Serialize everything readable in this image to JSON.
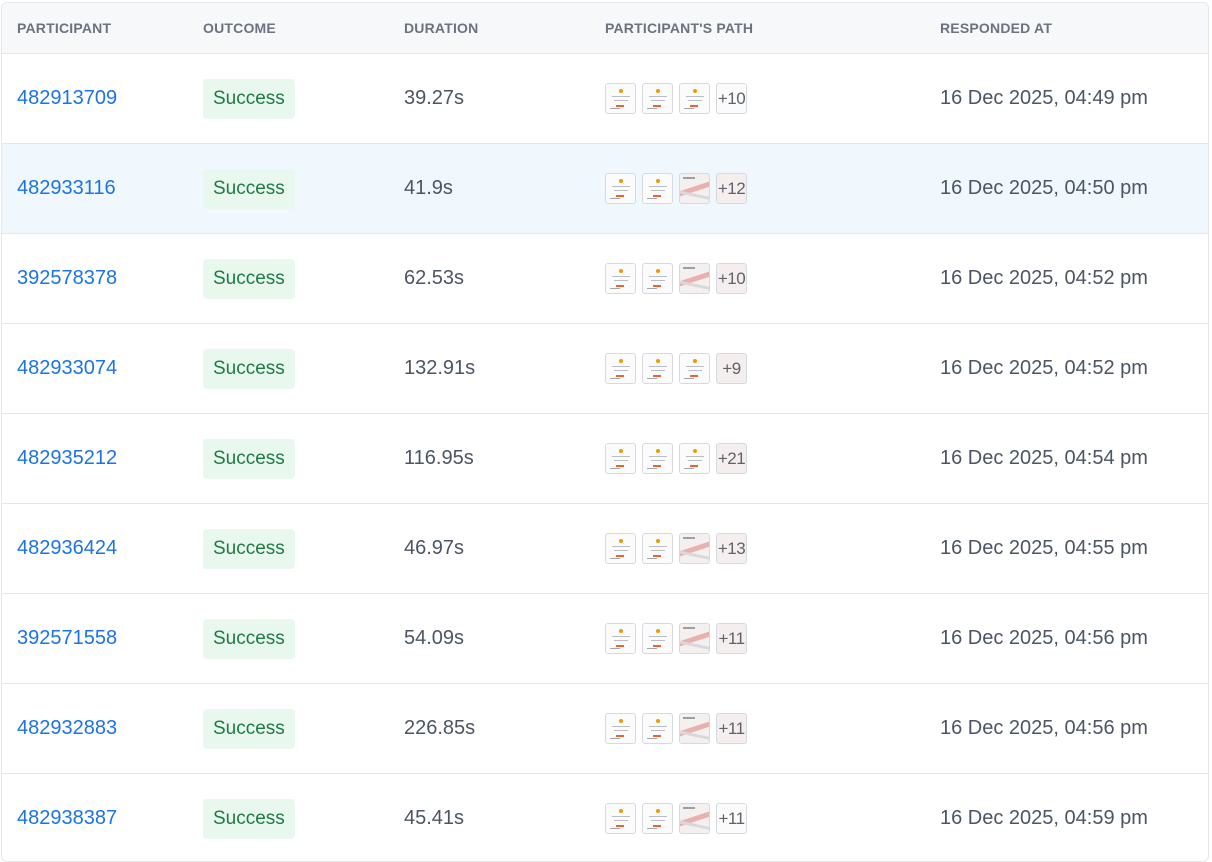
{
  "columns": {
    "participant": "PARTICIPANT",
    "outcome": "OUTCOME",
    "duration": "DURATION",
    "path": "PARTICIPANT'S PATH",
    "responded": "RESPONDED AT"
  },
  "rows": [
    {
      "participant": "482913709",
      "outcome": "Success",
      "duration": "39.27s",
      "path_more": "+10",
      "responded": "16 Dec 2025, 04:49 pm"
    },
    {
      "participant": "482933116",
      "outcome": "Success",
      "duration": "41.9s",
      "path_more": "+12",
      "responded": "16 Dec 2025, 04:50 pm"
    },
    {
      "participant": "392578378",
      "outcome": "Success",
      "duration": "62.53s",
      "path_more": "+10",
      "responded": "16 Dec 2025, 04:52 pm"
    },
    {
      "participant": "482933074",
      "outcome": "Success",
      "duration": "132.91s",
      "path_more": "+9",
      "responded": "16 Dec 2025, 04:52 pm"
    },
    {
      "participant": "482935212",
      "outcome": "Success",
      "duration": "116.95s",
      "path_more": "+21",
      "responded": "16 Dec 2025, 04:54 pm"
    },
    {
      "participant": "482936424",
      "outcome": "Success",
      "duration": "46.97s",
      "path_more": "+13",
      "responded": "16 Dec 2025, 04:55 pm"
    },
    {
      "participant": "392571558",
      "outcome": "Success",
      "duration": "54.09s",
      "path_more": "+11",
      "responded": "16 Dec 2025, 04:56 pm"
    },
    {
      "participant": "482932883",
      "outcome": "Success",
      "duration": "226.85s",
      "path_more": "+11",
      "responded": "16 Dec 2025, 04:56 pm"
    },
    {
      "participant": "482938387",
      "outcome": "Success",
      "duration": "45.41s",
      "path_more": "+11",
      "responded": "16 Dec 2025, 04:59 pm"
    }
  ],
  "colors": {
    "link": "#1a73e8",
    "success_text": "#1f7a44",
    "success_bg": "#e8f8ee",
    "highlight_row": "#f0f8fd",
    "header_bg": "#f7f8fa"
  }
}
